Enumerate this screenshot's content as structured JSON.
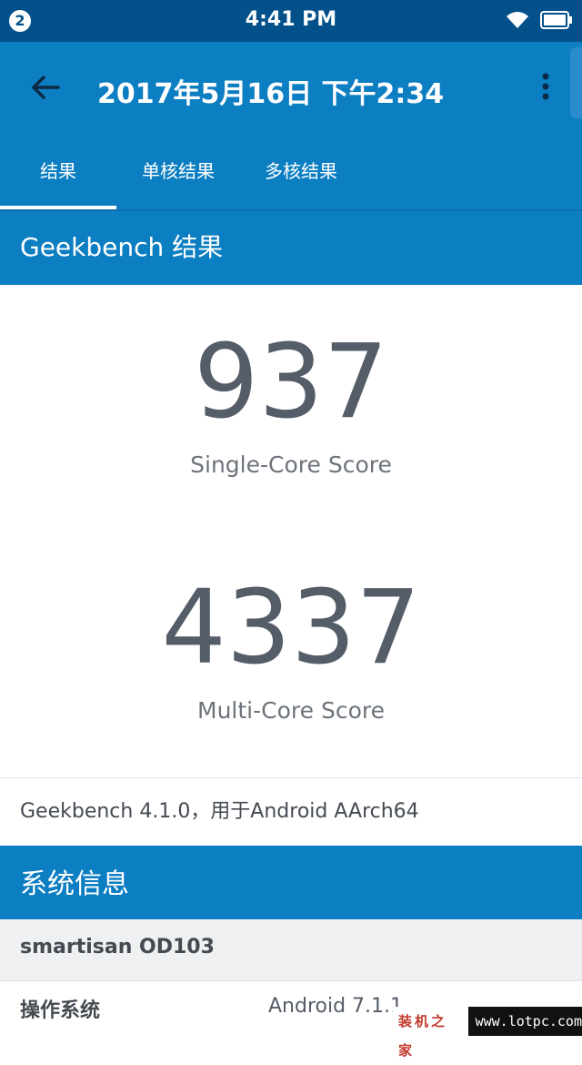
{
  "status_bar": {
    "notification_count": "2",
    "time": "4:41 PM",
    "icons": [
      "wifi-icon",
      "battery-icon"
    ]
  },
  "app_bar": {
    "title": "2017年5月16日 下午2:34",
    "back_icon": "arrow-left-icon",
    "menu_icon": "more-vert-icon"
  },
  "tabs": [
    {
      "label": "结果",
      "selected": true
    },
    {
      "label": "单核结果",
      "selected": false
    },
    {
      "label": "多核结果",
      "selected": false
    }
  ],
  "results": {
    "header": "Geekbench 结果",
    "single_core_score": "937",
    "single_core_label": "Single-Core Score",
    "multi_core_score": "4337",
    "multi_core_label": "Multi-Core Score",
    "version_line": "Geekbench 4.1.0，用于Android AArch64"
  },
  "system_info": {
    "header": "系统信息",
    "device": "smartisan OD103",
    "os_label": "操作系统",
    "os_value": "Android 7.1.1"
  },
  "watermark": {
    "label": "装机之家",
    "url": "www.lotpc.com"
  },
  "colors": {
    "status_bar": "#04508a",
    "primary": "#0c7ec2",
    "score_text": "#555d68"
  }
}
